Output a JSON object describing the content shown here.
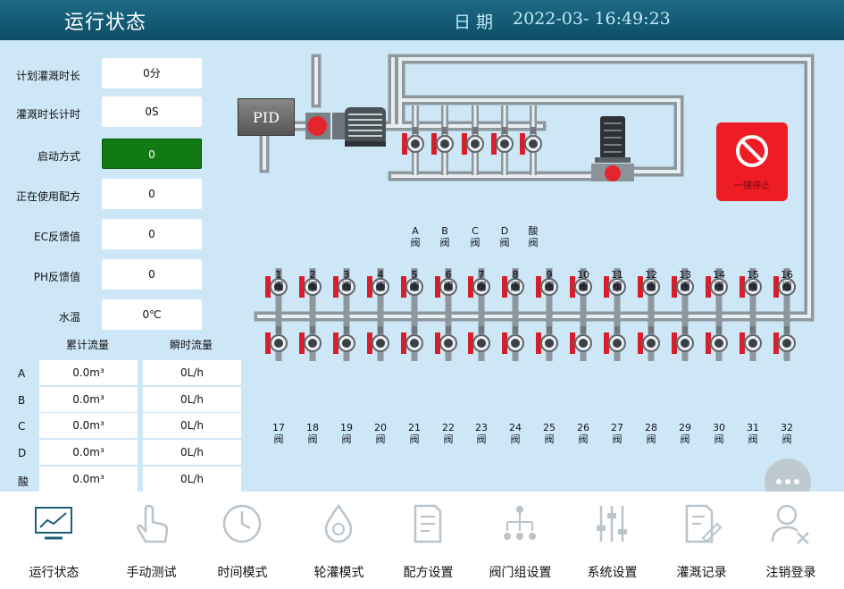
{
  "header": {
    "title": "运行状态",
    "date_label": "日期",
    "datetime": "2022-03- 16:49:23"
  },
  "params": [
    {
      "label": "计划灌溉时长",
      "value": "0分"
    },
    {
      "label": "灌溉时长计时",
      "value": "0S"
    },
    {
      "label": "启动方式",
      "value": "0"
    },
    {
      "label": "正在使用配方",
      "value": "0"
    },
    {
      "label": "EC反馈值",
      "value": "0"
    },
    {
      "label": "PH反馈值",
      "value": "0"
    },
    {
      "label": "水温",
      "value": "0℃"
    }
  ],
  "flow_table": {
    "headers": [
      "累计流量",
      "瞬时流量"
    ],
    "rows": [
      {
        "label": "A",
        "total": "0.0m³",
        "instant": "0L/h"
      },
      {
        "label": "B",
        "total": "0.0m³",
        "instant": "0L/h"
      },
      {
        "label": "C",
        "total": "0.0m³",
        "instant": "0L/h"
      },
      {
        "label": "D",
        "total": "0.0m³",
        "instant": "0L/h"
      },
      {
        "label": "酸",
        "total": "0.0m³",
        "instant": "0L/h"
      }
    ]
  },
  "pid_label": "PID",
  "stop_label": "一键停止",
  "mix_valves": [
    {
      "label": "A",
      "suffix": "阀"
    },
    {
      "label": "B",
      "suffix": "阀"
    },
    {
      "label": "C",
      "suffix": "阀"
    },
    {
      "label": "D",
      "suffix": "阀"
    },
    {
      "label": "酸",
      "suffix": "阀"
    }
  ],
  "top_valves": [
    "1",
    "2",
    "3",
    "4",
    "5",
    "6",
    "7",
    "8",
    "9",
    "10",
    "11",
    "12",
    "13",
    "14",
    "15",
    "16"
  ],
  "bottom_valves": [
    "17",
    "18",
    "19",
    "20",
    "21",
    "22",
    "23",
    "24",
    "25",
    "26",
    "27",
    "28",
    "29",
    "30",
    "31",
    "32"
  ],
  "valve_suffix": "阀",
  "more_label": "更多",
  "colors": {
    "header": "#145c78",
    "panel": "#cde7f7",
    "valve_red": "#d81e2a",
    "active": "#127a12"
  },
  "nav": [
    {
      "label": "运行状态",
      "icon": "monitor-chart-icon"
    },
    {
      "label": "手动测试",
      "icon": "hand-pointer-icon"
    },
    {
      "label": "时间模式",
      "icon": "clock-icon"
    },
    {
      "label": "轮灌模式",
      "icon": "water-drop-icon"
    },
    {
      "label": "配方设置",
      "icon": "document-icon"
    },
    {
      "label": "阀门组设置",
      "icon": "network-icon"
    },
    {
      "label": "系统设置",
      "icon": "sliders-icon"
    },
    {
      "label": "灌溉记录",
      "icon": "edit-record-icon"
    },
    {
      "label": "注销登录",
      "icon": "user-logout-icon"
    }
  ]
}
